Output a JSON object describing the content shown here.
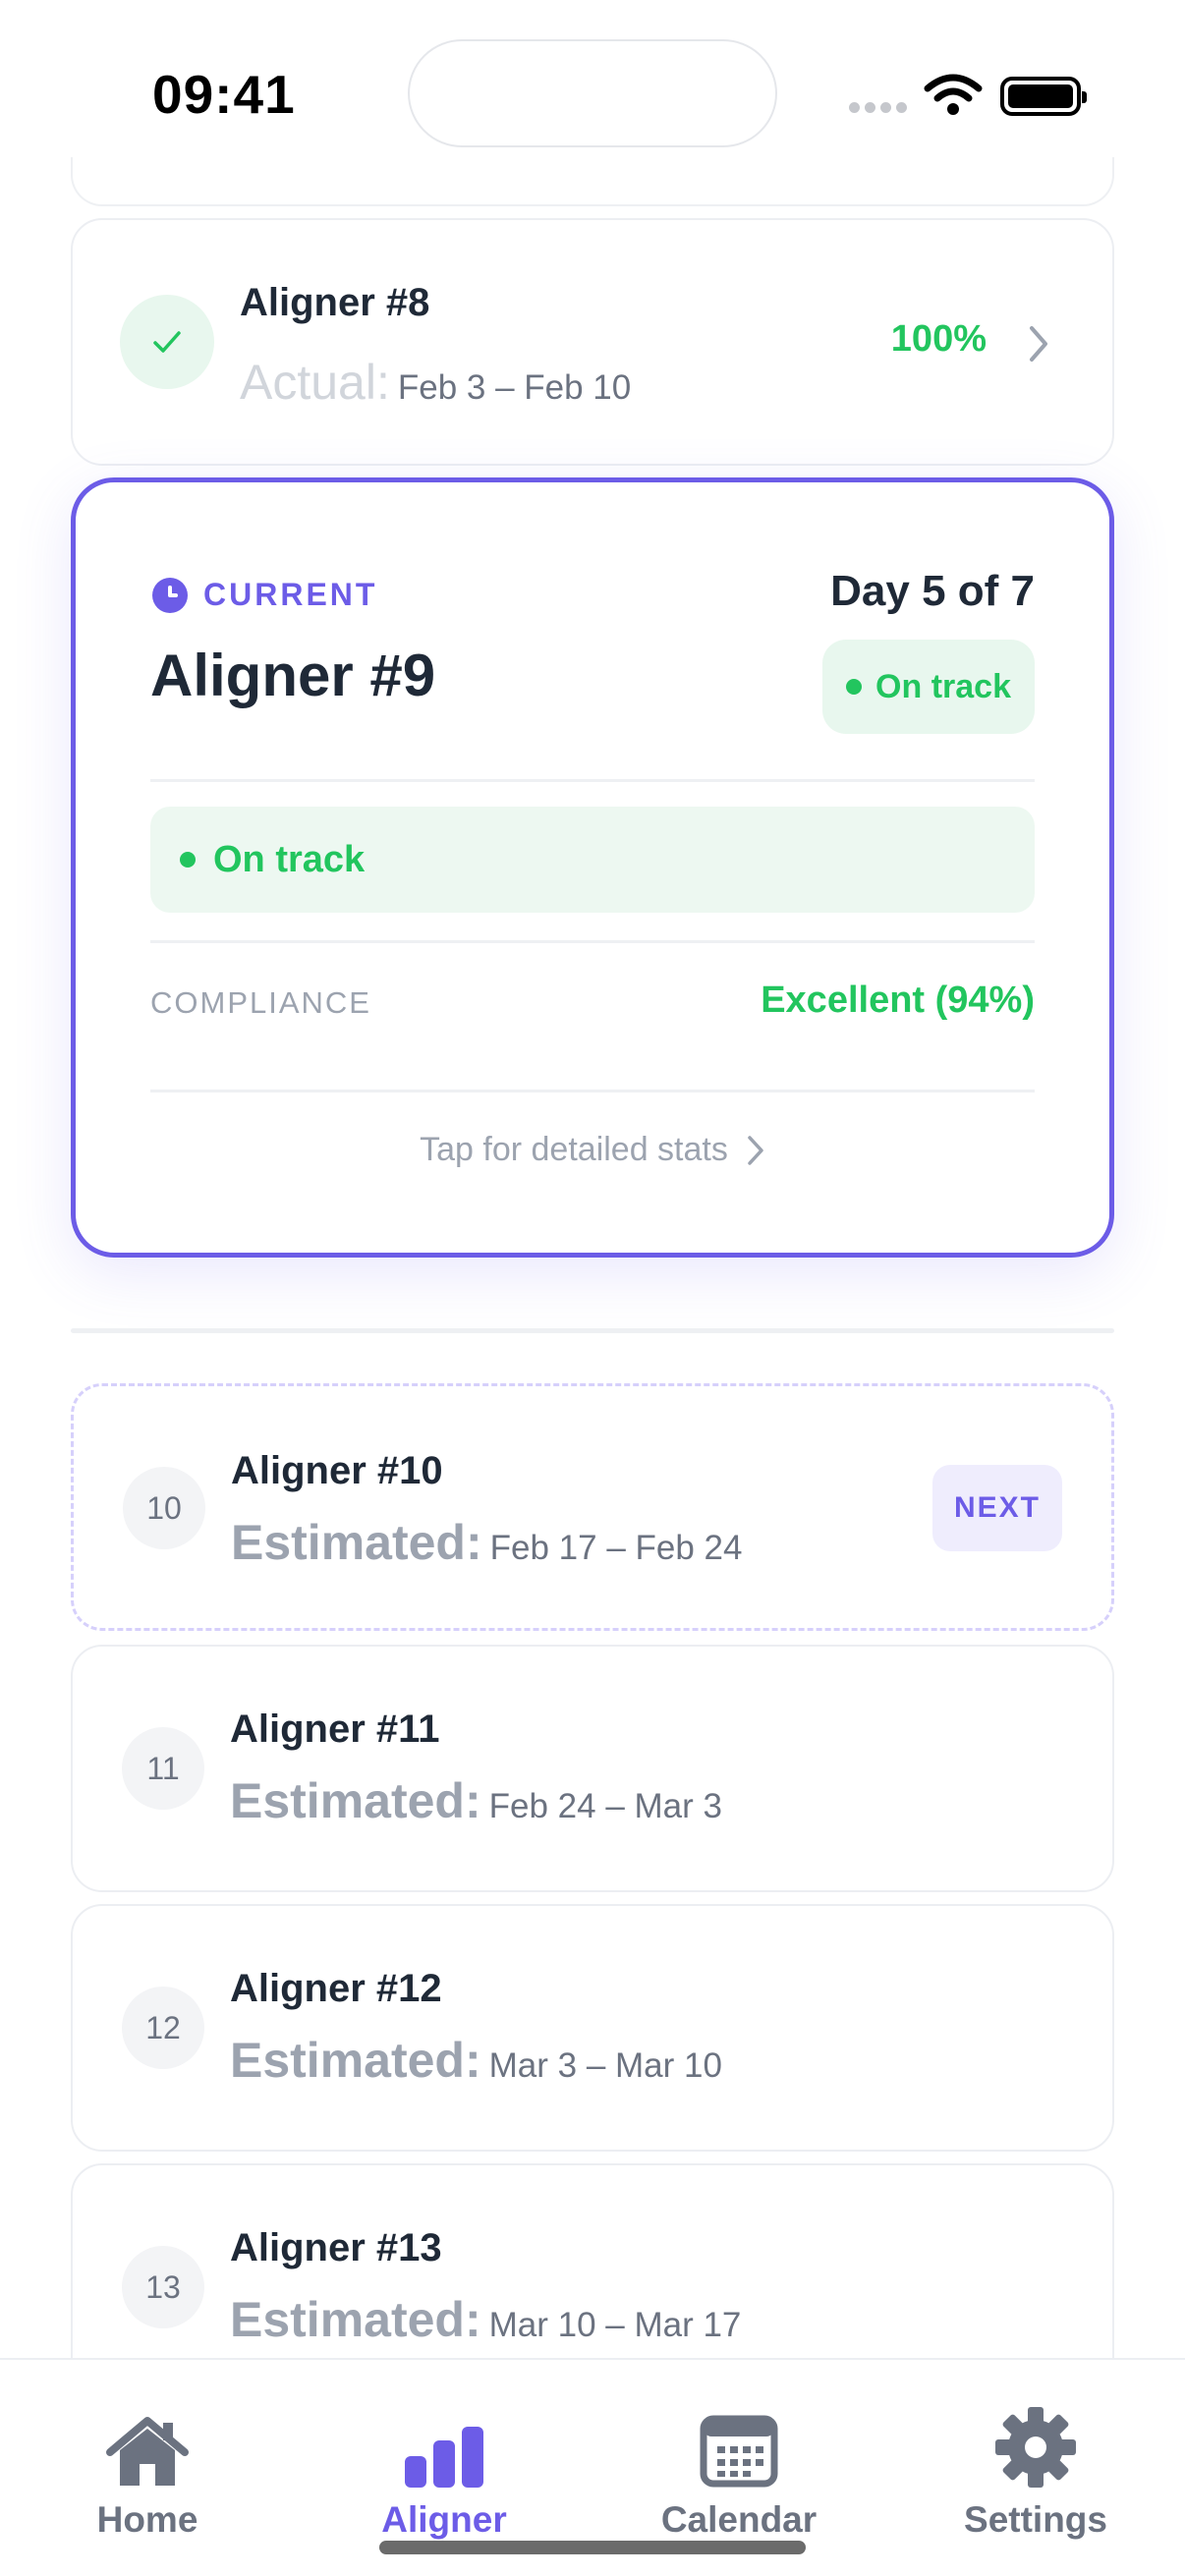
{
  "status_bar": {
    "time": "09:41"
  },
  "aligners": {
    "completed": {
      "title": "Aligner #8",
      "label": "Actual:",
      "dates": "Feb 3 – Feb 10",
      "percent": "100%"
    },
    "current": {
      "label": "CURRENT",
      "title": "Aligner #9",
      "day_count": "Day 5 of 7",
      "status_pill": "On track",
      "status_banner": "On track",
      "compliance_label": "COMPLIANCE",
      "compliance_value": "Excellent (94%)",
      "stats_link": "Tap for detailed stats"
    },
    "next": {
      "number": "10",
      "title": "Aligner #10",
      "label": "Estimated:",
      "dates": "Feb 17 – Feb 24",
      "badge": "NEXT"
    },
    "upcoming": [
      {
        "number": "11",
        "title": "Aligner #11",
        "label": "Estimated:",
        "dates": "Feb 24 – Mar 3"
      },
      {
        "number": "12",
        "title": "Aligner #12",
        "label": "Estimated:",
        "dates": "Mar 3 – Mar 10"
      },
      {
        "number": "13",
        "title": "Aligner #13",
        "label": "Estimated:",
        "dates": "Mar 10 – Mar 17"
      }
    ]
  },
  "tab_bar": {
    "items": [
      {
        "label": "Home",
        "icon": "home-icon"
      },
      {
        "label": "Aligner",
        "icon": "bar-chart-icon",
        "active": true
      },
      {
        "label": "Calendar",
        "icon": "calendar-icon"
      },
      {
        "label": "Settings",
        "icon": "gear-icon"
      }
    ]
  },
  "colors": {
    "accent": "#6c5ce7",
    "success": "#22c55e",
    "muted": "#9ca3af",
    "text": "#1f2937"
  }
}
